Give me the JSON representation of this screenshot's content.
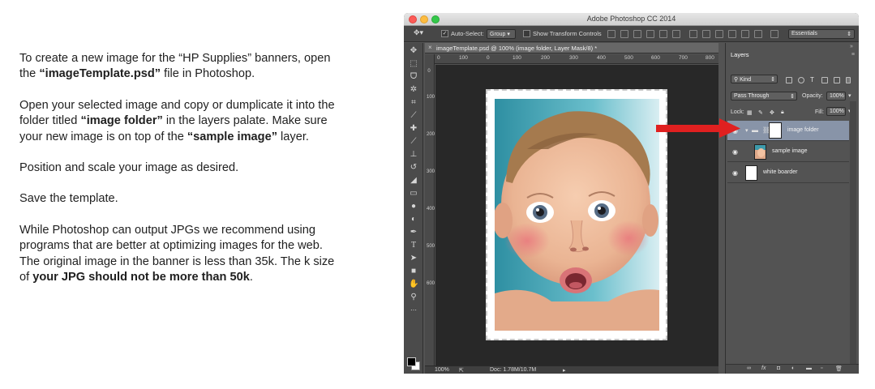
{
  "instructions": {
    "p1_a": "To create a new image for the “HP Supplies” banners, open the ",
    "p1_b": "“imageTemplate.psd”",
    "p1_c": " file in Photoshop.",
    "p2_a": "Open your selected image and copy or dumplicate it into the folder titled ",
    "p2_b": "“image folder”",
    "p2_c": " in the layers palate. Make sure your new image is on top of the ",
    "p2_d": "“sample image”",
    "p2_e": " layer.",
    "p3": "Position and scale your image as desired.",
    "p4": "Save the template.",
    "p5_a": "While Photoshop can output JPGs we recommend using programs that are better at optimizing images for the web. The original image in the banner is less than 35k. The k size of ",
    "p5_b": "your JPG should not be more than 50k",
    "p5_c": "."
  },
  "window": {
    "title": "Adobe Photoshop CC 2014"
  },
  "options_bar": {
    "auto_select_label": "Auto-Select:",
    "auto_select_value": "Group",
    "transform_label": "Show Transform Controls",
    "workspace": "Essentials"
  },
  "document": {
    "tab_title": "imageTemplate.psd @ 100% (image folder, Layer Mask/8) *",
    "ruler_h": [
      "0",
      "100",
      "0",
      "100",
      "200",
      "300",
      "400",
      "500",
      "600",
      "700",
      "800"
    ],
    "ruler_v": [
      "0",
      "100",
      "200",
      "300",
      "400",
      "500",
      "600"
    ],
    "zoom": "100%",
    "doc_size": "Doc: 1.78M/10.7M"
  },
  "layers_panel": {
    "tab_label": "Layers",
    "filter_kind": "Kind",
    "blend_mode": "Pass Through",
    "opacity_label": "Opacity:",
    "opacity_value": "100%",
    "lock_label": "Lock:",
    "fill_label": "Fill:",
    "fill_value": "100%",
    "layers": [
      {
        "name": "image folder",
        "selected": true
      },
      {
        "name": "sample image",
        "selected": false
      },
      {
        "name": "white boarder",
        "selected": false
      }
    ]
  },
  "colors": {
    "arrow": "#e02020",
    "selected_layer": "#8894a8",
    "app_background": "#535353"
  }
}
